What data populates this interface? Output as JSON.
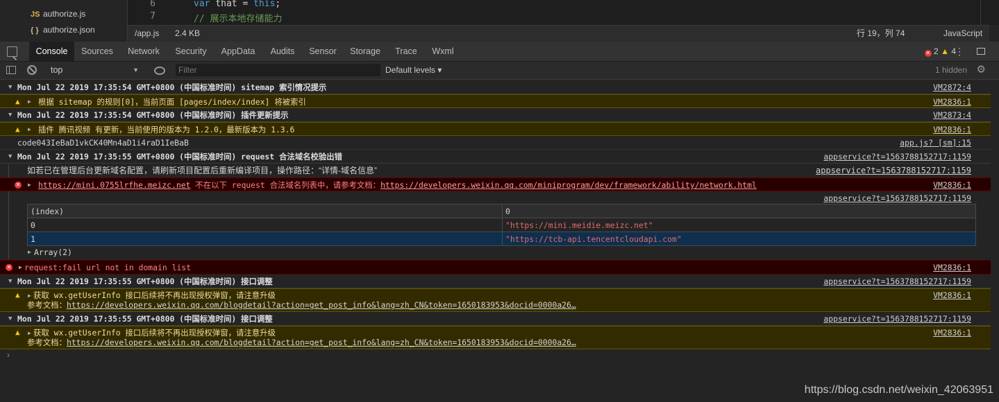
{
  "file_tree": [
    {
      "icon": "JS",
      "name": "authorize.js"
    },
    {
      "icon": "{ }",
      "name": "authorize.json"
    }
  ],
  "editor": {
    "lines": [
      {
        "num": "6",
        "keyword": "var",
        "rest": " that = ",
        "keyword2": "this",
        "end": ";"
      },
      {
        "num": "7",
        "comment": "// 展示本地存储能力"
      }
    ]
  },
  "statusbar": {
    "file": "/app.js",
    "size": "2.4 KB",
    "position": "行 19，列 74",
    "language": "JavaScript"
  },
  "tabs": [
    "Console",
    "Sources",
    "Network",
    "Security",
    "AppData",
    "Audits",
    "Sensor",
    "Storage",
    "Trace",
    "Wxml"
  ],
  "active_tab": "Console",
  "counts": {
    "errors": "2",
    "warnings": "4"
  },
  "filterbar": {
    "context": "top",
    "filter_placeholder": "Filter",
    "levels": "Default levels ▾",
    "hidden": "1 hidden"
  },
  "console": {
    "rows": [
      {
        "type": "group",
        "text": "Mon Jul 22 2019 17:35:54 GMT+0800 (中国标准时间) sitemap 索引情况提示",
        "src": "VM2872:4"
      },
      {
        "type": "warn",
        "text": "根据 sitemap 的规则[0]，当前页面 [pages/index/index] 将被索引",
        "src": "VM2836:1"
      },
      {
        "type": "group",
        "text": "Mon Jul 22 2019 17:35:54 GMT+0800 (中国标准时间) 插件更新提示",
        "src": "VM2873:4"
      },
      {
        "type": "warn",
        "text": "插件 腾讯视频 有更新，当前使用的版本为 1.2.0，最新版本为 1.3.6",
        "src": "VM2836:1"
      },
      {
        "type": "plain",
        "text": "code043IeBaD1vkCK40Mn4aD1i4raD1IeBaB",
        "src": "app.js? [sm]:15"
      },
      {
        "type": "group",
        "text": "Mon Jul 22 2019 17:35:55 GMT+0800 (中国标准时间) request 合法域名校验出错",
        "src": "appservice?t=1563788152717:1159"
      },
      {
        "type": "info",
        "text": "如若已在管理后台更新域名配置，请刷新项目配置后重新编译项目，操作路径：“详情-域名信息”",
        "src": "appservice?t=1563788152717:1159"
      },
      {
        "type": "error",
        "link1": "https://mini.0755lrfhe.meizc.net",
        "mid": " 不在以下 request 合法域名列表中，请参考文档：",
        "link2": "https://developers.weixin.qq.com/miniprogram/dev/framework/ability/network.html",
        "src": "VM2836:1"
      },
      {
        "type": "src_only",
        "src": "appservice?t=1563788152717:1159"
      },
      {
        "type": "array",
        "text": "Array(2)"
      },
      {
        "type": "error2",
        "text": "request:fail url not in domain list",
        "src": "VM2836:1"
      },
      {
        "type": "group",
        "text": "Mon Jul 22 2019 17:35:55 GMT+0800 (中国标准时间) 接口调整",
        "src": "appservice?t=1563788152717:1159"
      },
      {
        "type": "warn2",
        "text": "获取 wx.getUserInfo 接口后续将不再出现授权弹窗，请注意升级",
        "ref_label": "参考文档：",
        "ref_link": "https://developers.weixin.qq.com/blogdetail?action=get_post_info&lang=zh_CN&token=1650183953&docid=0000a26…",
        "src": "VM2836:1"
      },
      {
        "type": "group",
        "text": "Mon Jul 22 2019 17:35:55 GMT+0800 (中国标准时间) 接口调整",
        "src": "appservice?t=1563788152717:1159"
      },
      {
        "type": "warn2",
        "text": "获取 wx.getUserInfo 接口后续将不再出现授权弹窗，请注意升级",
        "ref_label": "参考文档：",
        "ref_link": "https://developers.weixin.qq.com/blogdetail?action=get_post_info&lang=zh_CN&token=1650183953&docid=0000a26…",
        "src": "VM2836:1"
      }
    ],
    "table": {
      "headers": [
        "(index)",
        "0"
      ],
      "rows": [
        [
          "0",
          "\"https://mini.meidie.meizc.net\""
        ],
        [
          "1",
          "\"https://tcb-api.tencentcloudapi.com\""
        ]
      ]
    }
  },
  "watermark": "https://blog.csdn.net/weixin_42063951"
}
